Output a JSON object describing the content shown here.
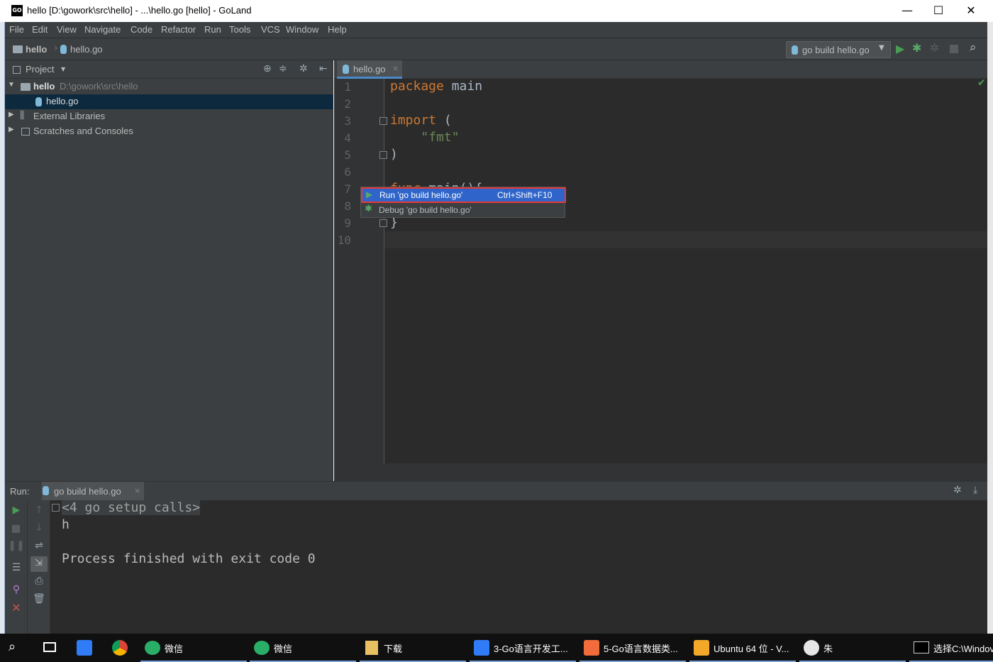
{
  "window": {
    "logo": "GO",
    "title": "hello [D:\\gowork\\src\\hello] - ...\\hello.go [hello] - GoLand",
    "minimize_glyph": "—",
    "maximize_glyph": "☐",
    "close_glyph": "✕"
  },
  "menu": [
    "File",
    "Edit",
    "View",
    "Navigate",
    "Code",
    "Refactor",
    "Run",
    "Tools",
    "VCS",
    "Window",
    "Help"
  ],
  "breadcrumb": {
    "project": "hello",
    "file": "hello.go"
  },
  "run_config": {
    "label": "go build hello.go"
  },
  "project_panel": {
    "title": "Project",
    "tree": [
      {
        "label": "hello",
        "path": "D:\\gowork\\src\\hello"
      },
      {
        "label": "hello.go"
      },
      {
        "label": "External Libraries"
      },
      {
        "label": "Scratches and Consoles"
      }
    ]
  },
  "editor": {
    "tab_label": "hello.go",
    "line_numbers": [
      "1",
      "2",
      "3",
      "4",
      "5",
      "6",
      "7",
      "8",
      "9",
      "10"
    ],
    "code": {
      "l1_kw": "package",
      "l1_rest": " main",
      "l3_kw": "import",
      "l3_rest": " (",
      "l4_str": "\"fmt\"",
      "l5": ")",
      "l7_kw": "func",
      "l7_rest": " main(){",
      "l9": "}"
    }
  },
  "popup": {
    "run_label": "Run 'go build hello.go'",
    "run_shortcut": "Ctrl+Shift+F10",
    "debug_label": "Debug 'go build hello.go'"
  },
  "run_window": {
    "label": "Run:",
    "tab_label": "go build hello.go",
    "output": {
      "setup": "<4 go setup calls>",
      "line1": "h",
      "line2": "Process finished with exit code 0"
    }
  },
  "taskbar": [
    {
      "label": "微信"
    },
    {
      "label": "微信"
    },
    {
      "label": "下载"
    },
    {
      "label": "3-Go语言开发工..."
    },
    {
      "label": "5-Go语言数据类..."
    },
    {
      "label": "Ubuntu 64 位 - V..."
    },
    {
      "label": "朱"
    },
    {
      "label": "选择C:\\Windov"
    }
  ],
  "colors": {
    "keyword": "#cc7832",
    "string": "#6a8759",
    "run_green": "#499c54",
    "debug_green": "#59a869",
    "close_red": "#c75450",
    "selection_blue": "#2f65ca",
    "highlight_red": "#e53935"
  }
}
